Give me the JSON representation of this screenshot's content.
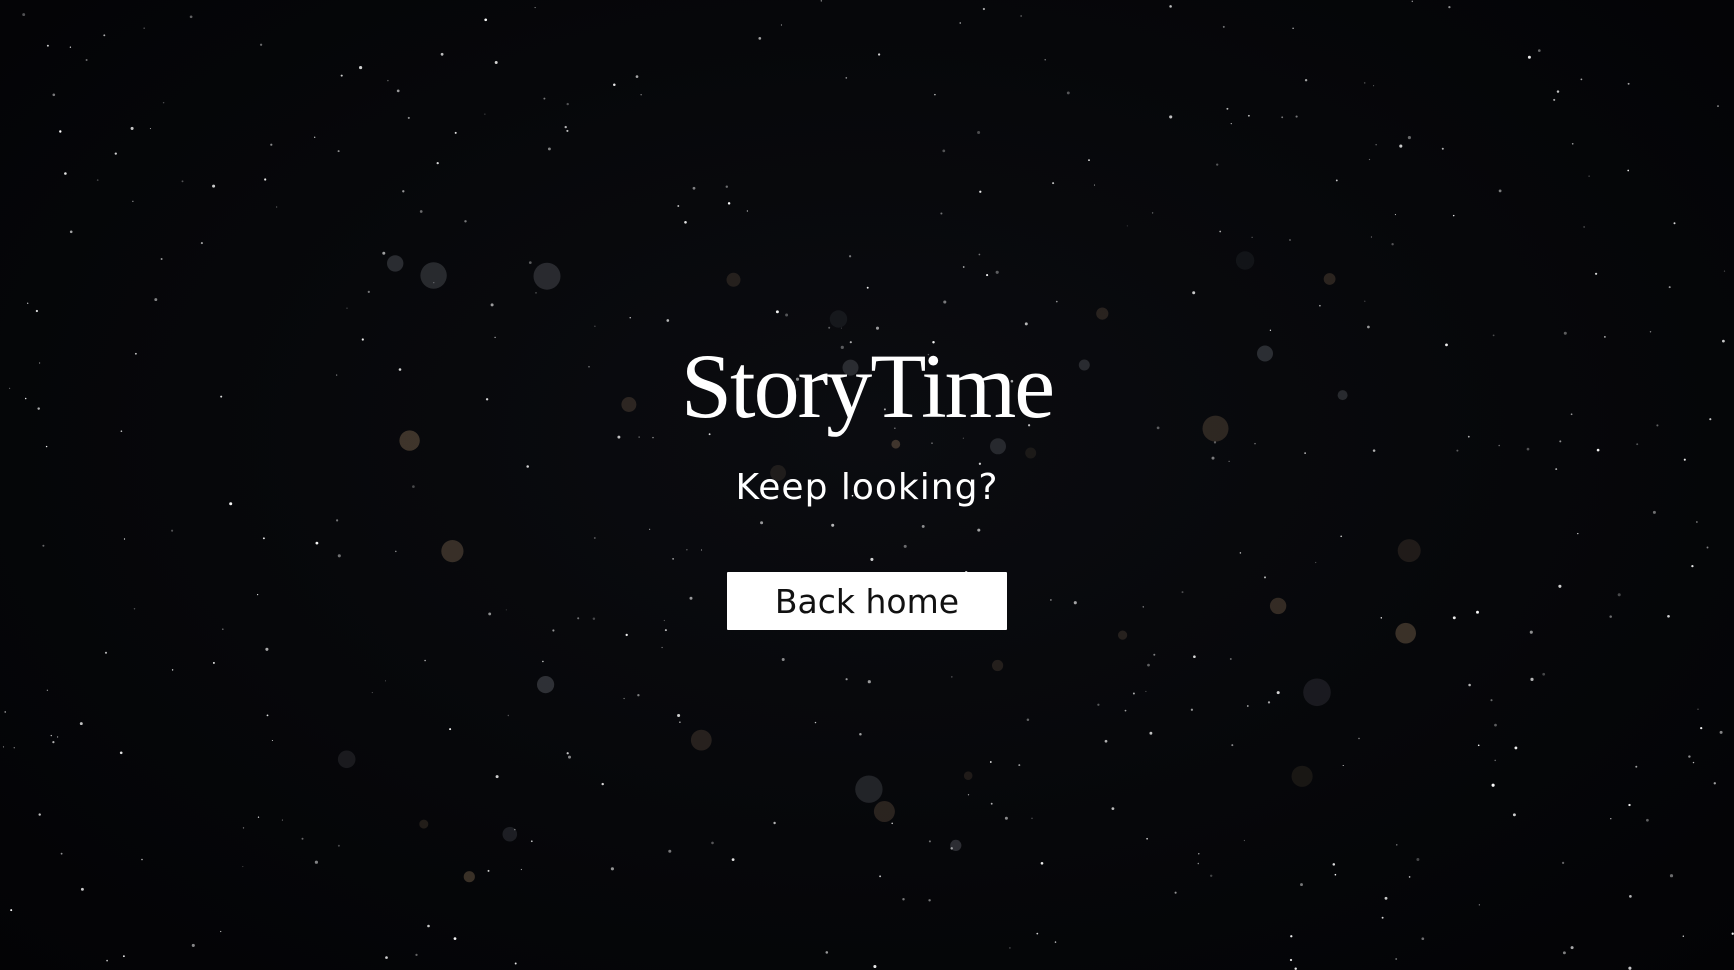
{
  "brand": {
    "logo_text": "StoryTime"
  },
  "message": {
    "tagline": "Keep looking?"
  },
  "actions": {
    "back_home_label": "Back home"
  },
  "background": {
    "image_name": "starfield-background",
    "base_color": "#050608",
    "star_color": "#ffffff",
    "bokeh_color": "#c9a27a"
  },
  "colors": {
    "text": "#ffffff",
    "button_bg": "#ffffff",
    "button_text": "#111111"
  }
}
